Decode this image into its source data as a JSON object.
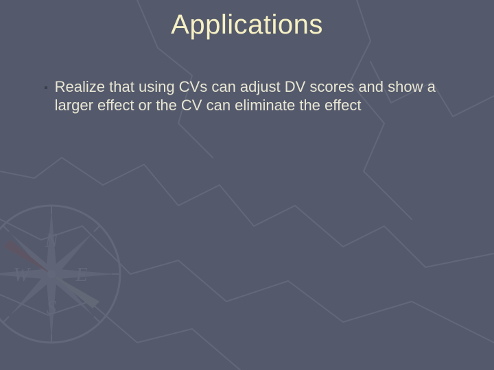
{
  "title": "Applications",
  "bullets": [
    "Realize that using CVs can adjust DV scores and show a larger effect or the CV can eliminate the effect"
  ],
  "colors": {
    "background": "#545a6b",
    "title": "#f6f0c4",
    "body": "#e9e6d4",
    "bullet": "#3b3f4c",
    "mapLines": "#757b8c"
  }
}
